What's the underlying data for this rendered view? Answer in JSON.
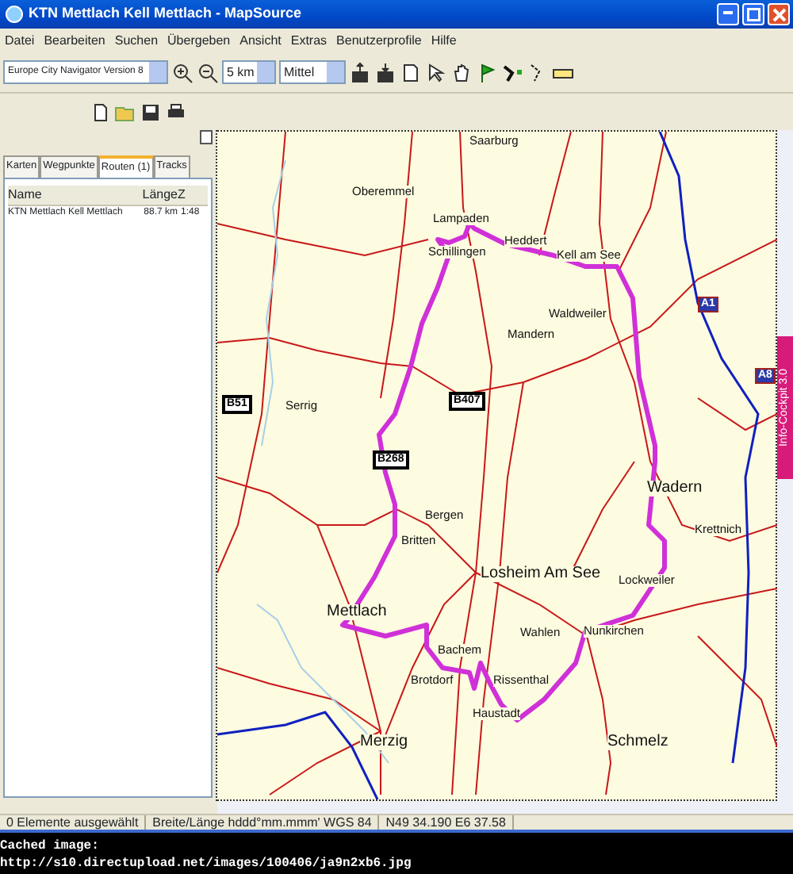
{
  "window": {
    "title": "KTN Mettlach Kell Mettlach - MapSource"
  },
  "menu": [
    "Datei",
    "Bearbeiten",
    "Suchen",
    "Übergeben",
    "Ansicht",
    "Extras",
    "Benutzerprofile",
    "Hilfe"
  ],
  "toolbar": {
    "map_product": "Europe City Navigator Version 8",
    "zoom": "5 km",
    "detail": "Mittel"
  },
  "tabs": [
    {
      "label": "Karten",
      "selected": false
    },
    {
      "label": "Wegpunkte",
      "selected": false
    },
    {
      "label": "Routen (1)",
      "selected": true
    },
    {
      "label": "Tracks",
      "selected": false
    }
  ],
  "routes_list": {
    "columns": [
      "Name",
      "Länge",
      "Z"
    ],
    "rows": [
      {
        "name": "KTN Mettlach Kell Mettlach",
        "length": "88.7 km",
        "column_3": "1:48"
      }
    ]
  },
  "map": {
    "places": [
      {
        "name": "Saarburg",
        "kind": "village"
      },
      {
        "name": "Oberemmel",
        "kind": "village"
      },
      {
        "name": "Lampaden",
        "kind": "village"
      },
      {
        "name": "Schillingen",
        "kind": "village"
      },
      {
        "name": "Heddert",
        "kind": "village"
      },
      {
        "name": "Kell am See",
        "kind": "village"
      },
      {
        "name": "Waldweiler",
        "kind": "village"
      },
      {
        "name": "Mandern",
        "kind": "village"
      },
      {
        "name": "Serrig",
        "kind": "village"
      },
      {
        "name": "Wadern",
        "kind": "town"
      },
      {
        "name": "Bergen",
        "kind": "village"
      },
      {
        "name": "Britten",
        "kind": "village"
      },
      {
        "name": "Krettnich",
        "kind": "village"
      },
      {
        "name": "Losheim Am See",
        "kind": "town"
      },
      {
        "name": "Lockweiler",
        "kind": "village"
      },
      {
        "name": "Mettlach",
        "kind": "town"
      },
      {
        "name": "Wahlen",
        "kind": "village"
      },
      {
        "name": "Nunkirchen",
        "kind": "village"
      },
      {
        "name": "Bachem",
        "kind": "village"
      },
      {
        "name": "Brotdorf",
        "kind": "village"
      },
      {
        "name": "Rissenthal",
        "kind": "village"
      },
      {
        "name": "Haustadt",
        "kind": "village"
      },
      {
        "name": "Merzig",
        "kind": "town"
      },
      {
        "name": "Schmelz",
        "kind": "town"
      }
    ],
    "road_shields": [
      {
        "label": "B51",
        "kind": "federal"
      },
      {
        "label": "B407",
        "kind": "federal"
      },
      {
        "label": "B268",
        "kind": "federal"
      },
      {
        "label": "A1",
        "kind": "motorway"
      },
      {
        "label": "A8",
        "kind": "motorway"
      }
    ],
    "side_tab": "Info-Cockpit 3.0"
  },
  "status_bar": [
    "0 Elemente ausgewählt",
    "Breite/Länge hddd°mm.mmm' WGS 84",
    "N49 34.190 E6 37.58"
  ],
  "caption": {
    "label": "Cached image:",
    "url": "http://s10.directupload.net/images/100406/ja9n2xb6.jpg"
  }
}
